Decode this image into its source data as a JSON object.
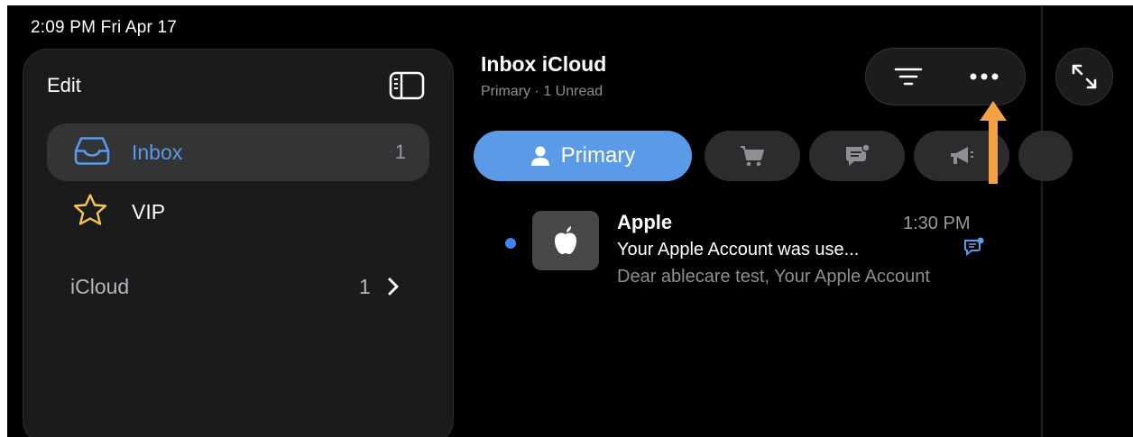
{
  "status_bar": {
    "time": "2:09 PM  Fri Apr 17"
  },
  "sidebar": {
    "edit_label": "Edit",
    "items": [
      {
        "label": "Inbox",
        "count": "1",
        "icon": "tray-icon"
      },
      {
        "label": "VIP",
        "count": "",
        "icon": "star-icon"
      }
    ],
    "account": {
      "label": "iCloud",
      "count": "1"
    }
  },
  "main": {
    "title": "Inbox iCloud",
    "subtitle": "Primary · 1 Unread"
  },
  "filters": [
    {
      "label": "Primary",
      "icon": "person-icon",
      "selected": true
    },
    {
      "label": "",
      "icon": "cart-icon"
    },
    {
      "label": "",
      "icon": "chat-bubble-icon"
    },
    {
      "label": "",
      "icon": "megaphone-icon"
    }
  ],
  "messages": [
    {
      "sender": "Apple",
      "time": "1:30 PM",
      "subject": "Your Apple Account was use...",
      "preview": "Dear ablecare test, Your Apple Account",
      "unread": true
    }
  ],
  "colors": {
    "accent": "#5a9ae6",
    "unread_dot": "#3f86ee",
    "annotation_arrow": "#f5a245",
    "vip_star": "#f7c84a"
  }
}
